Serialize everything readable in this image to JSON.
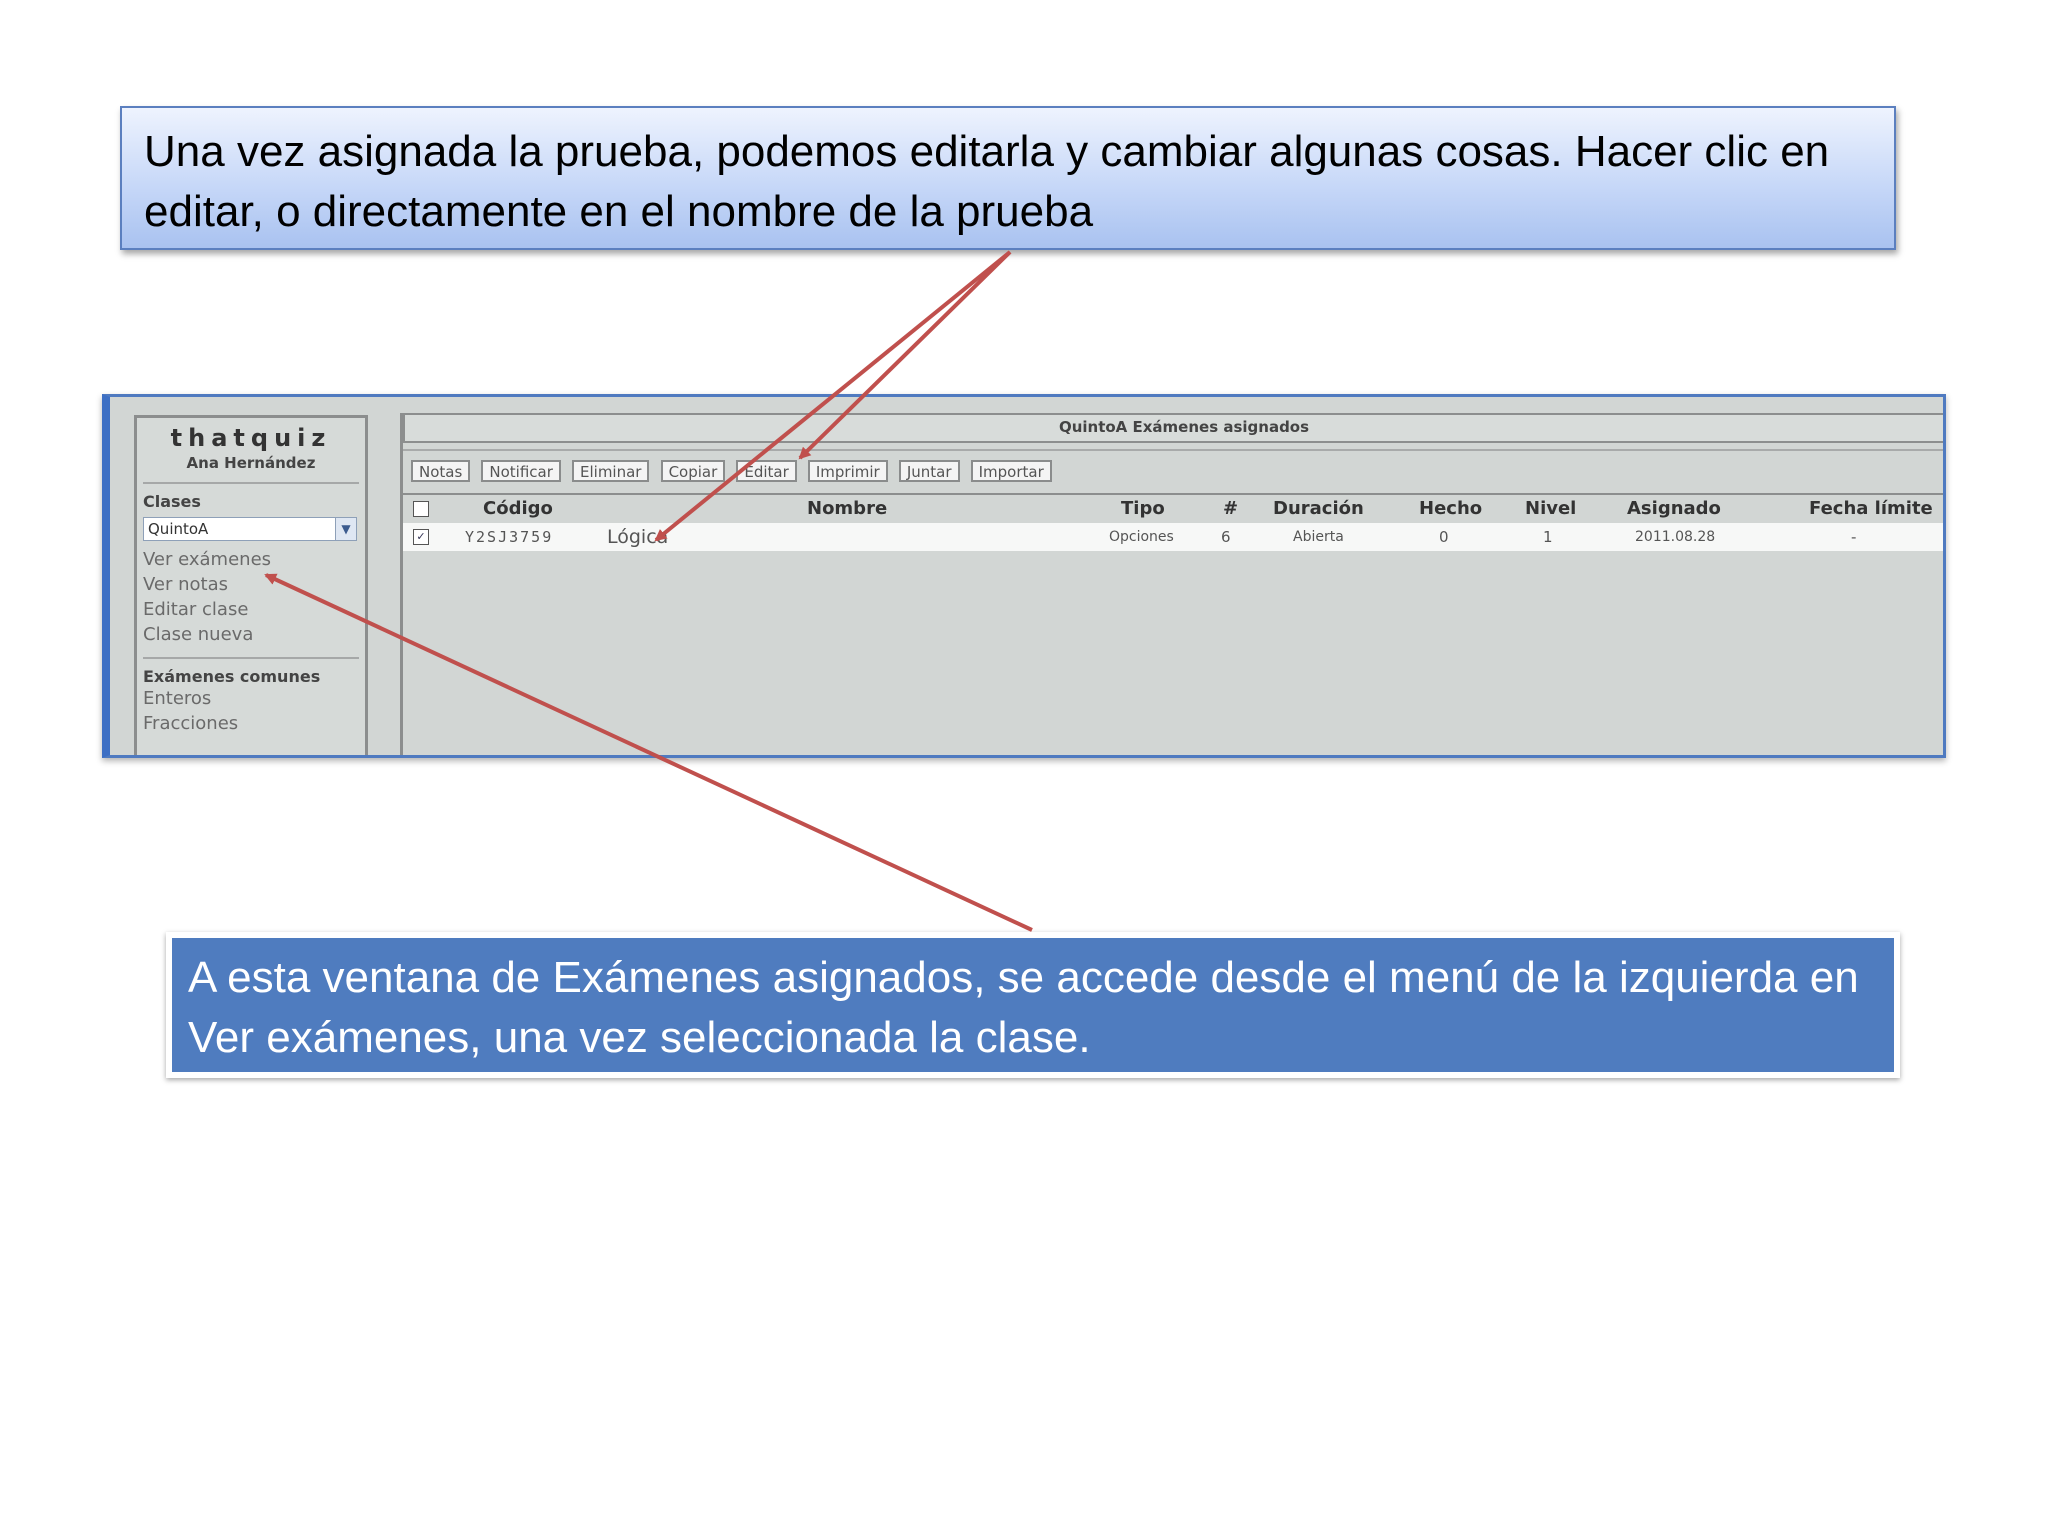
{
  "callouts": {
    "top": "Una vez asignada la prueba, podemos editarla y cambiar algunas cosas. Hacer clic en editar, o directamente en el nombre de la prueba",
    "bottom": "A esta ventana  de Exámenes asignados, se accede desde el menú de la izquierda en Ver exámenes, una vez seleccionada la clase."
  },
  "app": {
    "brand": "thatquiz",
    "user": "Ana Hernández",
    "sidebar": {
      "classes_heading": "Clases",
      "class_selected": "QuintoA",
      "links": [
        "Ver exámenes",
        "Ver notas",
        "Editar clase",
        "Clase nueva"
      ],
      "common_heading": "Exámenes comunes",
      "common_links": [
        "Enteros",
        "Fracciones"
      ]
    },
    "main": {
      "title": "QuintoA   Exámenes asignados",
      "toolbar": [
        "Notas",
        "Notificar",
        "Eliminar",
        "Copiar",
        "Editar",
        "Imprimir",
        "Juntar",
        "Importar"
      ],
      "columns": [
        "Código",
        "Nombre",
        "Tipo",
        "#",
        "Duración",
        "Hecho",
        "Nivel",
        "Asignado",
        "Fecha límite"
      ],
      "rows": [
        {
          "checked": true,
          "codigo": "Y2SJ3759",
          "nombre": "Lógica",
          "tipo": "Opciones",
          "num": "6",
          "duracion": "Abierta",
          "hecho": "0",
          "nivel": "1",
          "asignado": "2011.08.28",
          "fecha_limite": "-"
        }
      ]
    }
  },
  "colors": {
    "arrow": "#c0504d",
    "bottom_callout": "#4f7cbf",
    "app_border": "#4f7ac0"
  }
}
